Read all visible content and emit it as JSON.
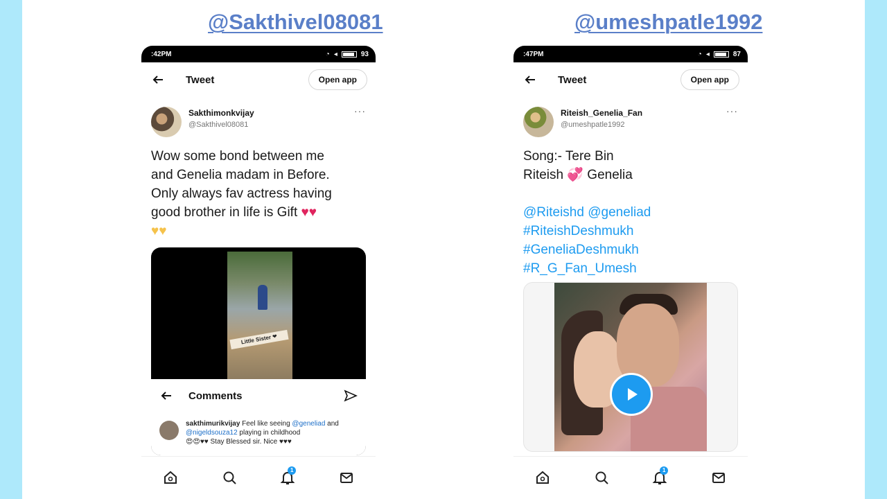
{
  "colors": {
    "background": "#aee9fb",
    "handle": "#5a7fc8",
    "link": "#1d9bf0",
    "heart": "#e0245e"
  },
  "left": {
    "handle": "@Sakthivel08081",
    "status_time": ":42PM",
    "status_battery": "93",
    "topbar": {
      "title": "Tweet",
      "open_app": "Open app"
    },
    "author": {
      "display_name": "Sakthimonkvijay",
      "username": "@Sakthivel08081"
    },
    "more": "···",
    "text": "Wow some bond between me\nand Genelia madam in Before.\nOnly always fav actress having\ngood brother in life is Gift ",
    "hearts_red": "♥♥",
    "hearts_yellow": "♥♥",
    "media": {
      "sticker": "Little Sister ❤",
      "comments_title": "Comments",
      "comment": {
        "user": "sakthimurikvijay",
        "pre": " Feel like seeing ",
        "mention1": "@geneliad",
        "mid": " and ",
        "mention2": "@nigeldsouza12",
        "post": " playing in childhood",
        "line2": "😍😍♥♥ Stay Blessed sir. Nice ♥♥♥"
      }
    },
    "nav": {
      "notification_count": "1"
    }
  },
  "right": {
    "handle": "@umeshpatle1992",
    "status_time": ":47PM",
    "status_battery": "87",
    "topbar": {
      "title": "Tweet",
      "open_app": "Open app"
    },
    "author": {
      "display_name": "Riteish_Genelia_Fan",
      "username": "@umeshpatle1992"
    },
    "more": "···",
    "text": "Song:- Tere Bin\nRiteish 💞 Genelia",
    "mentions": [
      "@Riteishd @geneliad",
      "#RiteishDeshmukh",
      "#GeneliaDeshmukh",
      "#R_G_Fan_Umesh"
    ],
    "nav": {
      "notification_count": "1"
    }
  }
}
